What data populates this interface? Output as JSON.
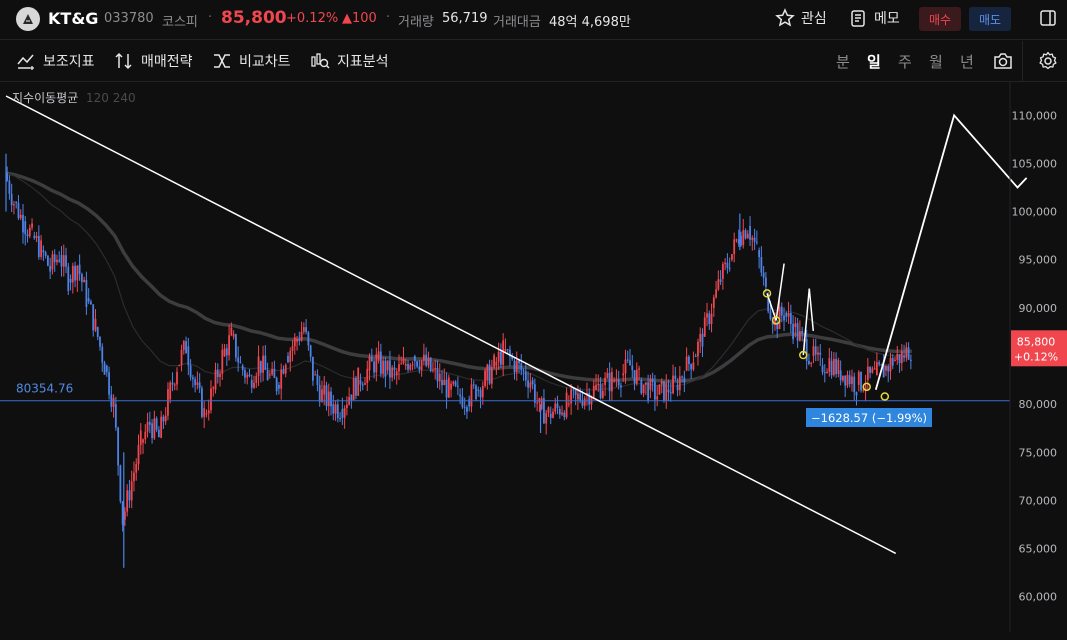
{
  "header": {
    "name": "KT&G",
    "code": "033780",
    "market": "코스피",
    "dot": "·",
    "price": "85,800",
    "change_pct": "+0.12%",
    "change_abs": "▲100",
    "volume_label": "거래량",
    "volume_value": "56,719",
    "amount_label": "거래대금",
    "amount_value": "48억 4,698만",
    "favorite_label": "관심",
    "memo_label": "메모",
    "buy_label": "매수",
    "sell_label": "매도"
  },
  "toolbar": {
    "indicator_label": "보조지표",
    "strategy_label": "매매전략",
    "compare_label": "비교차트",
    "analysis_label": "지표분석",
    "periods": [
      "분",
      "일",
      "주",
      "월",
      "년"
    ],
    "active_period": "일"
  },
  "colors": {
    "up": "#f0474f",
    "down": "#4d83e6",
    "background": "#0f0f10",
    "hline": "#3a6fd1",
    "measure_bg": "#2e86de",
    "pivot": "#e8d73a",
    "drawing": "#ffffff"
  },
  "icons": [
    "stock-logo-icon",
    "star-icon",
    "memo-icon",
    "panel-icon",
    "indicator-icon",
    "strategy-icon",
    "compare-icon",
    "analysis-icon",
    "camera-icon",
    "gear-icon"
  ],
  "chart_data": {
    "type": "candlestick",
    "legend": {
      "label": "지수이동평균",
      "params": "120 240"
    },
    "y_ticks": [
      "110,000",
      "105,000",
      "100,000",
      "95,000",
      "90,000",
      "85,000",
      "80,000",
      "75,000",
      "70,000",
      "65,000",
      "60,000"
    ],
    "y_tick_values": [
      110000,
      105000,
      100000,
      95000,
      90000,
      85000,
      80000,
      75000,
      70000,
      65000,
      60000
    ],
    "ylim": [
      58000,
      112000
    ],
    "last_price": 85800,
    "last_label": "85,800",
    "last_change": "+0.12%",
    "hline_value": 80354.76,
    "hline_label": "80354.76",
    "measure_label": "−1628.57 (−1.99%)",
    "approx_closes": [
      104000,
      101000,
      99000,
      97500,
      96000,
      94000,
      95500,
      93000,
      94500,
      91000,
      88000,
      84000,
      80000,
      68000,
      72000,
      76000,
      78000,
      76500,
      80500,
      84000,
      86000,
      82000,
      79000,
      81500,
      85000,
      87000,
      84000,
      82500,
      84500,
      83000,
      82000,
      85000,
      86500,
      88000,
      83000,
      81000,
      80000,
      79500,
      81000,
      82500,
      83500,
      84500,
      83500,
      83000,
      84000,
      85000,
      84500,
      83500,
      82500,
      81500,
      81000,
      80500,
      81500,
      82500,
      84000,
      85500,
      84500,
      83500,
      82500,
      79500,
      79000,
      79500,
      80000,
      80500,
      81000,
      81500,
      82000,
      82500,
      83000,
      84000,
      82500,
      81500,
      81000,
      81500,
      82000,
      83500,
      85000,
      87000,
      90000,
      93000,
      95000,
      97500,
      98500,
      96000,
      91500,
      88500,
      89500,
      88000,
      86500,
      85000,
      84000,
      84500,
      83500,
      83000,
      82000,
      82500,
      83000,
      83500,
      84500,
      85000,
      85800
    ],
    "approx_highs": [
      106000,
      99800,
      92000
    ],
    "approx_lows": [
      63000,
      77000,
      80800
    ],
    "drawings": {
      "trendline": [
        {
          "i": 0,
          "v": 112000
        },
        {
          "i": 96,
          "v": 64500
        }
      ],
      "projection": [
        {
          "i": 96,
          "v": 81500
        },
        {
          "i": 102,
          "v": 110000
        },
        {
          "i": 109,
          "v": 102500
        },
        {
          "i": 110,
          "v": 103500
        }
      ],
      "pivots": [
        {
          "i": 84,
          "v": 91500
        },
        {
          "i": 85,
          "v": 88700
        },
        {
          "i": 88,
          "v": 85100
        },
        {
          "i": 95,
          "v": 81800
        },
        {
          "i": 97,
          "v": 80800
        }
      ]
    }
  }
}
